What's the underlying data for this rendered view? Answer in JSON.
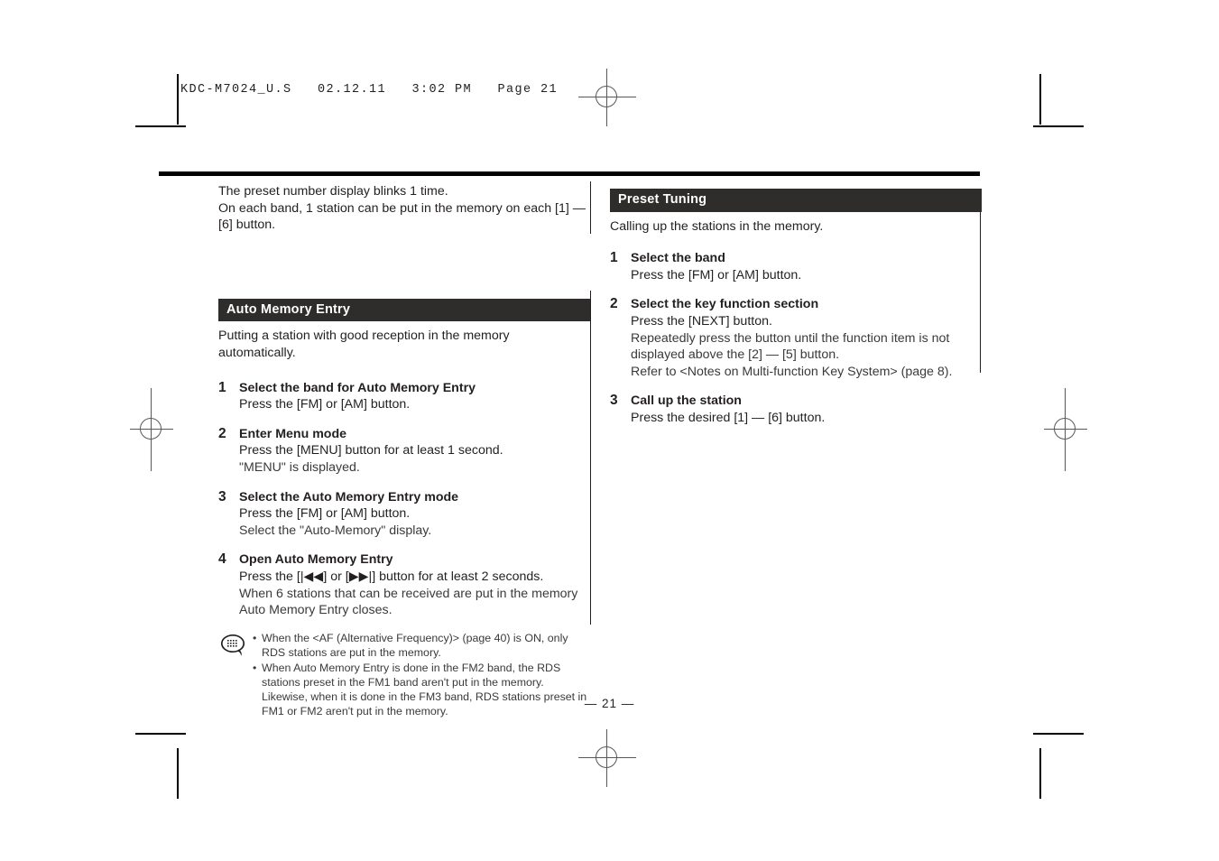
{
  "file_header": "KDC-M7024_U.S   02.12.11   3:02 PM   Page 21",
  "page_number": "— 21 —",
  "left_column": {
    "intro": [
      "The preset number display blinks 1 time.",
      "On each band, 1 station can be put in the memory on each [1] —",
      "[6] button."
    ],
    "section": {
      "title": "Auto Memory Entry",
      "description": [
        "Putting a station with good reception in the memory",
        "automatically."
      ],
      "steps": [
        {
          "num": "1",
          "title": "Select the band for Auto Memory Entry",
          "lines": [
            "Press the [FM] or [AM] button."
          ]
        },
        {
          "num": "2",
          "title": "Enter Menu mode",
          "lines": [
            "Press the [MENU] button for at least 1 second.",
            "\"MENU\" is displayed."
          ]
        },
        {
          "num": "3",
          "title": "Select the Auto Memory Entry mode",
          "lines": [
            "Press the [FM] or [AM] button.",
            "Select the \"Auto-Memory\" display."
          ]
        },
        {
          "num": "4",
          "title": "Open Auto Memory Entry",
          "lines": [
            "Press the [|◀◀] or [▶▶|] button for at least 2 seconds.",
            "When 6 stations that can be received are put in the memory",
            "Auto Memory Entry closes."
          ]
        }
      ],
      "note": {
        "icon": "speech-bubble-note-icon",
        "bullets": [
          "When the <AF (Alternative Frequency)> (page 40) is ON, only RDS stations are put in the memory.",
          "When Auto Memory Entry is done in the FM2 band, the RDS stations preset in the FM1 band aren't put in the memory. Likewise, when it is done in the FM3 band, RDS stations preset in FM1 or FM2 aren't put in the memory."
        ]
      }
    }
  },
  "right_column": {
    "section": {
      "title": "Preset Tuning",
      "description": [
        "Calling up the stations in the memory."
      ],
      "steps": [
        {
          "num": "1",
          "title": "Select the band",
          "lines": [
            "Press the [FM] or [AM] button."
          ]
        },
        {
          "num": "2",
          "title": "Select the key function section",
          "lines": [
            "Press the [NEXT] button.",
            "Repeatedly press the button until the function item is not",
            "displayed above the [2] — [5] button.",
            "Refer to <Notes on Multi-function Key System> (page 8)."
          ]
        },
        {
          "num": "3",
          "title": "Call up the station",
          "lines": [
            "Press the desired [1] — [6] button."
          ]
        }
      ]
    }
  }
}
